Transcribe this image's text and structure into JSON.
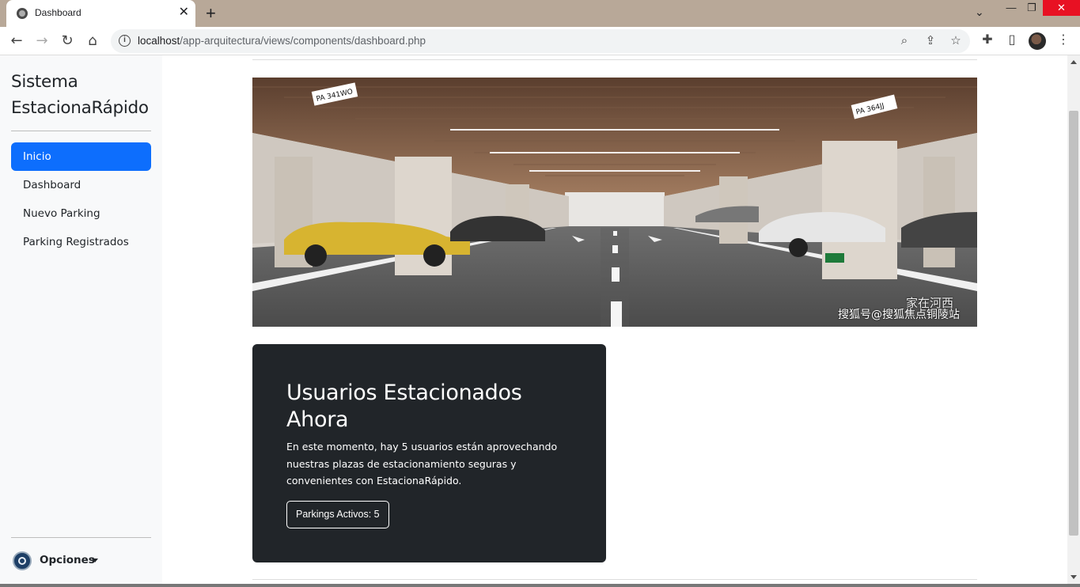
{
  "browser": {
    "tab_title": "Dashboard",
    "tab_close": "✕",
    "new_tab": "+",
    "url_host": "localhost",
    "url_path": "/app-arquitectura/views/components/dashboard.php",
    "window_min": "—",
    "window_max": "❐",
    "window_close": "✕"
  },
  "sidebar": {
    "brand_line1": "Sistema",
    "brand_line2": "EstacionaRápido",
    "items": [
      {
        "label": "Inicio",
        "active": true
      },
      {
        "label": "Dashboard",
        "active": false
      },
      {
        "label": "Nuevo Parking",
        "active": false
      },
      {
        "label": "Parking Registrados",
        "active": false
      }
    ],
    "options_label": "Opciones"
  },
  "hero": {
    "watermark_line1": "家在河西",
    "watermark_line2": "搜狐号@搜狐焦点铜陵站",
    "sign_left": "PA 341WO",
    "sign_right": "PA 364JJ"
  },
  "card": {
    "title": "Usuarios Estacionados Ahora",
    "text": "En este momento, hay 5 usuarios están aprovechando nuestras plazas de estacionamiento seguras y convenientes con EstacionaRápido.",
    "button_label": "Parkings Activos: 5"
  },
  "icons": {
    "favicon": "globe-icon",
    "back": "arrow-left-icon",
    "forward": "arrow-right-icon",
    "reload": "reload-icon",
    "home": "home-icon",
    "info": "info-icon",
    "zoom": "zoom-icon",
    "share": "share-icon",
    "star": "star-icon",
    "extensions": "puzzle-icon",
    "sidepanel": "side-panel-icon",
    "menu": "kebab-menu-icon"
  },
  "colors": {
    "primary": "#0d6efd",
    "sidebar_bg": "#f8f9fa",
    "card_bg": "#212529"
  }
}
